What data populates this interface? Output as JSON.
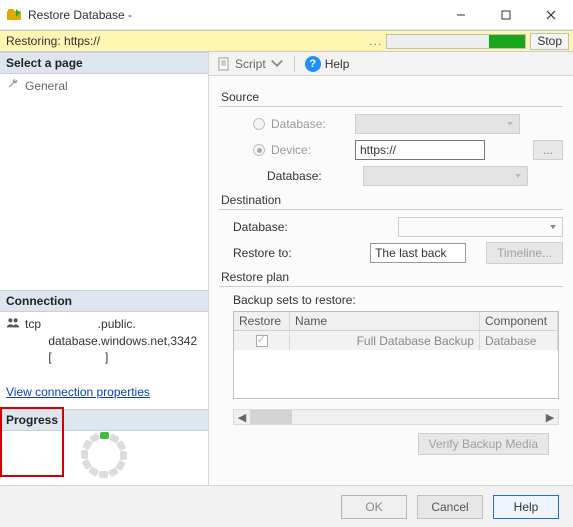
{
  "window": {
    "title": "Restore Database -"
  },
  "ribbon": {
    "label": "Restoring: https://",
    "dots": "...",
    "stop": "Stop"
  },
  "sidebar": {
    "select_page": "Select a page",
    "general": "General",
    "connection_head": "Connection",
    "conn_line": "tcp                 .public.\n       database.windows.net,3342\n       [                ]",
    "view_props": "View connection properties",
    "progress_head": "Progress"
  },
  "toolbar": {
    "script": "Script",
    "help": "Help"
  },
  "source": {
    "title": "Source",
    "database_label": "Database:",
    "device_label": "Device:",
    "device_value": "https://",
    "browse_dots": "...",
    "sub_database_label": "Database:"
  },
  "destination": {
    "title": "Destination",
    "database_label": "Database:",
    "restore_to_label": "Restore to:",
    "restore_to_value": "The last back",
    "timeline_btn": "Timeline..."
  },
  "plan": {
    "title": "Restore plan",
    "subtitle": "Backup sets to restore:",
    "cols": {
      "restore": "Restore",
      "name": "Name",
      "component": "Component"
    },
    "row": {
      "name": "Full Database Backup",
      "component": "Database"
    },
    "verify_btn": "Verify Backup Media"
  },
  "footer": {
    "ok": "OK",
    "cancel": "Cancel",
    "help": "Help"
  }
}
